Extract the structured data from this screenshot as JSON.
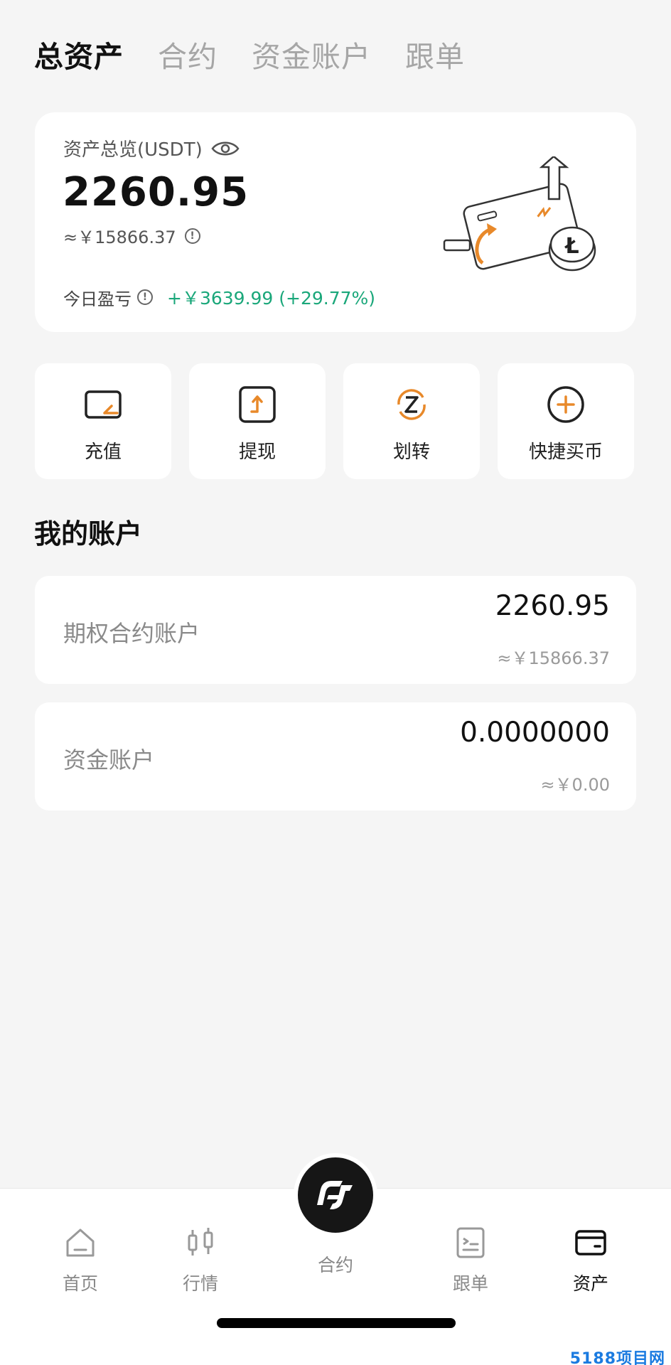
{
  "top_tabs": [
    {
      "label": "总资产",
      "active": true
    },
    {
      "label": "合约",
      "active": false
    },
    {
      "label": "资金账户",
      "active": false
    },
    {
      "label": "跟单",
      "active": false
    }
  ],
  "overview": {
    "title": "资产总览(USDT)",
    "amount": "2260.95",
    "cny": "≈￥15866.37",
    "pnl_label": "今日盈亏",
    "pnl_value": "+￥3639.99 (+29.77%)"
  },
  "actions": [
    {
      "label": "充值",
      "icon": "deposit-icon"
    },
    {
      "label": "提现",
      "icon": "withdraw-icon"
    },
    {
      "label": "划转",
      "icon": "transfer-icon"
    },
    {
      "label": "快捷买币",
      "icon": "quick-buy-icon"
    }
  ],
  "section_title": "我的账户",
  "accounts": [
    {
      "name": "期权合约账户",
      "amount": "2260.95",
      "cny": "≈￥15866.37"
    },
    {
      "name": "资金账户",
      "amount": "0.0000000",
      "cny": "≈￥0.00"
    }
  ],
  "bottom_nav": [
    {
      "label": "首页",
      "icon": "home-icon",
      "active": false
    },
    {
      "label": "行情",
      "icon": "candlestick-icon",
      "active": false
    },
    {
      "label": "合约",
      "icon": "contract-logo-icon",
      "active": false
    },
    {
      "label": "跟单",
      "icon": "copy-trade-icon",
      "active": false
    },
    {
      "label": "资产",
      "icon": "wallet-icon",
      "active": true
    }
  ],
  "colors": {
    "accent": "#e8892a",
    "profit": "#1aa77a",
    "background": "#f5f5f5"
  },
  "watermark": "5188项目网"
}
